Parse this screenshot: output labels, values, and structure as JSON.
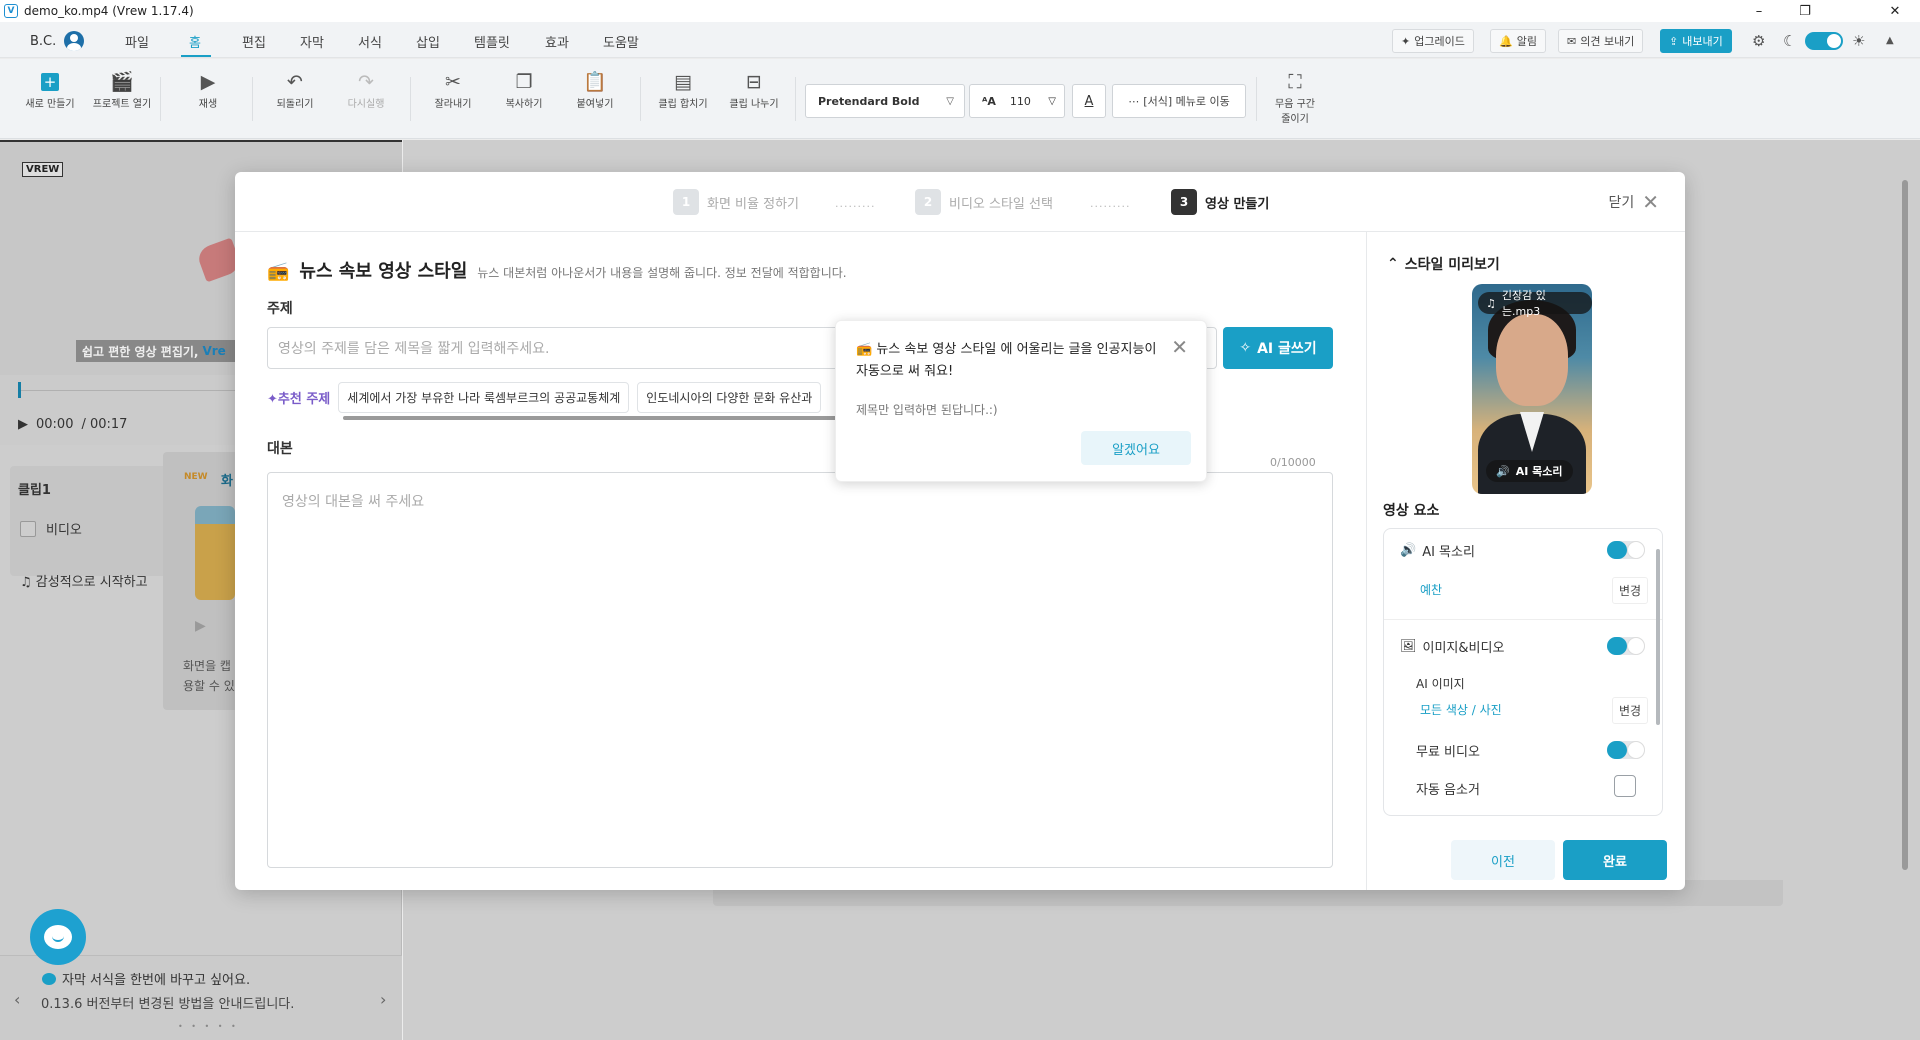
{
  "window": {
    "title": "demo_ko.mp4 (Vrew 1.17.4)",
    "app_icon": "V",
    "minimize": "–",
    "restore": "❐",
    "close": "✕"
  },
  "menubar": {
    "user": "B.C.",
    "items": [
      "파일",
      "홈",
      "편집",
      "자막",
      "서식",
      "삽입",
      "템플릿",
      "효과",
      "도움말"
    ],
    "active_index": 1,
    "upgrade": "업그레이드",
    "notifications": "알림",
    "feedback": "의견 보내기",
    "export": "내보내기"
  },
  "toolbar": {
    "new": "새로 만들기",
    "open": "프로젝트 열기",
    "play": "재생",
    "undo": "되돌리기",
    "redo": "다시실행",
    "cut": "잘라내기",
    "copy": "복사하기",
    "paste": "붙여넣기",
    "merge": "클립 합치기",
    "split": "클립 나누기",
    "font": "Pretendard Bold",
    "font_size": "110",
    "format_move": "[서식] 메뉴로 이동",
    "silence_line1": "무음 구간",
    "silence_line2": "줄이기"
  },
  "background": {
    "logo": "VREW",
    "caption": "쉽고 편한 영상 편집기,",
    "caption_brand": "Vre",
    "time_current": "00:00",
    "time_total": "/ 00:17",
    "clip_title": "클립1",
    "clip_video": "비디오",
    "clip_music": "감성적으로 시작하고",
    "new_badge": "NEW",
    "new_title": "화",
    "card_line1": "화면을 캡",
    "card_line2": "용할 수 있",
    "tip_title": "자막 서식을 한번에 바꾸고 싶어요.",
    "tip_sub": "0.13.6 버전부터 변경된 방법을 안내드립니다.",
    "tip_dots": "• • • • •"
  },
  "modal": {
    "steps": [
      {
        "num": "1",
        "label": "화면 비율 정하기"
      },
      {
        "num": "2",
        "label": "비디오 스타일 선택"
      },
      {
        "num": "3",
        "label": "영상 만들기"
      }
    ],
    "step_dots": "·········",
    "close_label": "닫기",
    "style_title": "뉴스 속보 영상 스타일",
    "style_desc": "뉴스 대본처럼 아나운서가 내용을 설명해 줍니다. 정보 전달에 적합합니다.",
    "topic_label": "주제",
    "topic_placeholder": "영상의 주제를 담은 제목을 짧게 입력해주세요.",
    "ai_write": "AI 글쓰기",
    "recommend_label": "추천 주제",
    "recommend_chips": [
      "세계에서 가장 부유한 나라 룩셈부르크의 공공교통체계",
      "인도네시아의 다양한 문화 유산과"
    ],
    "script_label": "대본",
    "script_count": "0/10000",
    "script_placeholder": "영상의 대본을 써 주세요",
    "popover": {
      "title": "뉴스 속보 영상 스타일 에 어울리는 글을 인공지능이 자동으로 써 줘요!",
      "body": "제목만 입력하면 된답니다.:)",
      "ok": "알겠어요"
    },
    "side": {
      "preview_title": "스타일 미리보기",
      "music_tag": "긴장감 있는.mp3",
      "voice_tag": "AI 목소리",
      "elements_title": "영상 요소",
      "ai_voice": "AI 목소리",
      "ai_voice_on": true,
      "voice_name": "예찬",
      "change": "변경",
      "image_video": "이미지&비디오",
      "image_video_on": true,
      "ai_image": "AI 이미지",
      "ai_image_style": "모든 색상 / 사진",
      "free_video": "무료 비디오",
      "free_video_on": true,
      "auto_mute": "자동 음소거",
      "auto_mute_checked": false
    },
    "prev": "이전",
    "done": "완료"
  },
  "colors": {
    "accent": "#1a9fc6",
    "recommend": "#7a5cc9"
  }
}
